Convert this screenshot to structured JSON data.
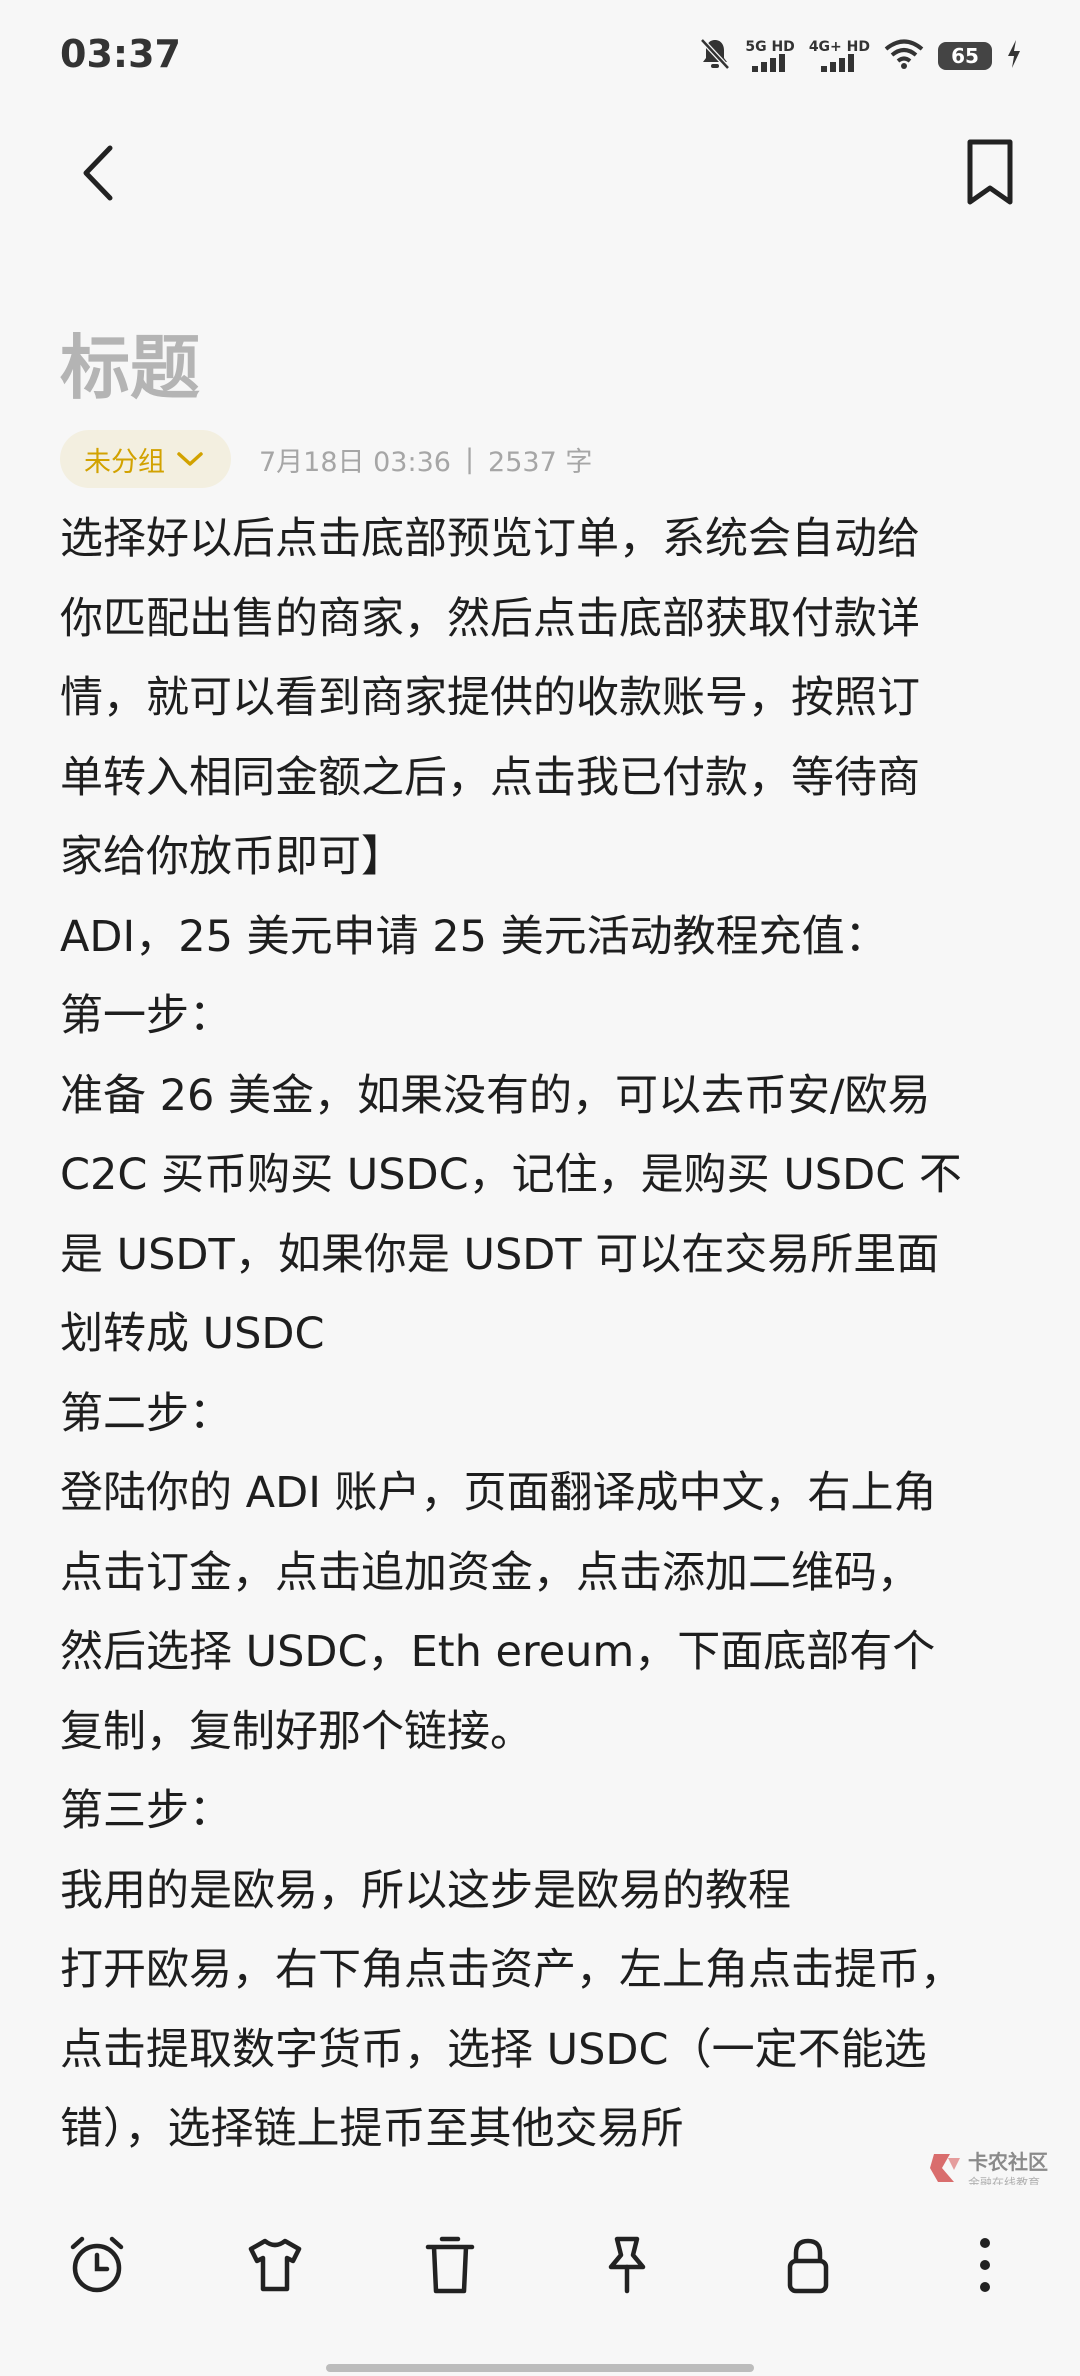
{
  "status_bar": {
    "time": "03:37",
    "net1": "5G HD",
    "net2": "4G+ HD",
    "battery": "65",
    "icons": [
      "bell-muted-icon",
      "signal-icon",
      "wifi-icon",
      "battery-icon",
      "charging-icon"
    ]
  },
  "top_bar": {
    "back_icon": "chevron-left-icon",
    "bookmark_icon": "bookmark-icon"
  },
  "note": {
    "title": "标题",
    "group": "未分组",
    "date": "7月18日 03:36",
    "separator": "|",
    "word_count": "2537 字",
    "lines": [
      "选择好以后点击底部预览订单，系统会自动给",
      "你匹配出售的商家，然后点击底部获取付款详",
      "情，就可以看到商家提供的收款账号，按照订",
      "单转入相同金额之后，点击我已付款，等待商",
      "家给你放币即可】",
      "ADI，25 美元申请 25 美元活动教程充值：",
      "第一步：",
      "准备 26 美金，如果没有的，可以去币安/欧易",
      "C2C 买币购买 USDC，记住，是购买 USDC 不",
      "是 USDT，如果你是 USDT 可以在交易所里面",
      "划转成 USDC",
      "第二步：",
      "登陆你的 ADI 账户，页面翻译成中文，右上角",
      "点击订金，点击追加资金，点击添加二维码，",
      "然后选择 USDC，Eth ereum，下面底部有个",
      "复制，复制好那个链接。",
      "第三步：",
      "我用的是欧易，所以这步是欧易的教程",
      "打开欧易，右下角点击资产，左上角点击提币，",
      "点击提取数字货币，选择 USDC（一定不能选",
      "错），选择链上提币至其他交易所"
    ]
  },
  "toolbar": {
    "items": [
      "alarm-clock-icon",
      "tshirt-icon",
      "trash-icon",
      "pin-icon",
      "lock-icon",
      "more-vertical-icon"
    ]
  },
  "watermark": {
    "name": "卡农社区",
    "sub": "金融在线教育"
  },
  "colors": {
    "background": "#f7f7f7",
    "title_gray": "#b4b4b4",
    "accent_gold": "#d2a200",
    "chip_bg": "#f3efe0",
    "meta_gray": "#a6a6a6"
  }
}
